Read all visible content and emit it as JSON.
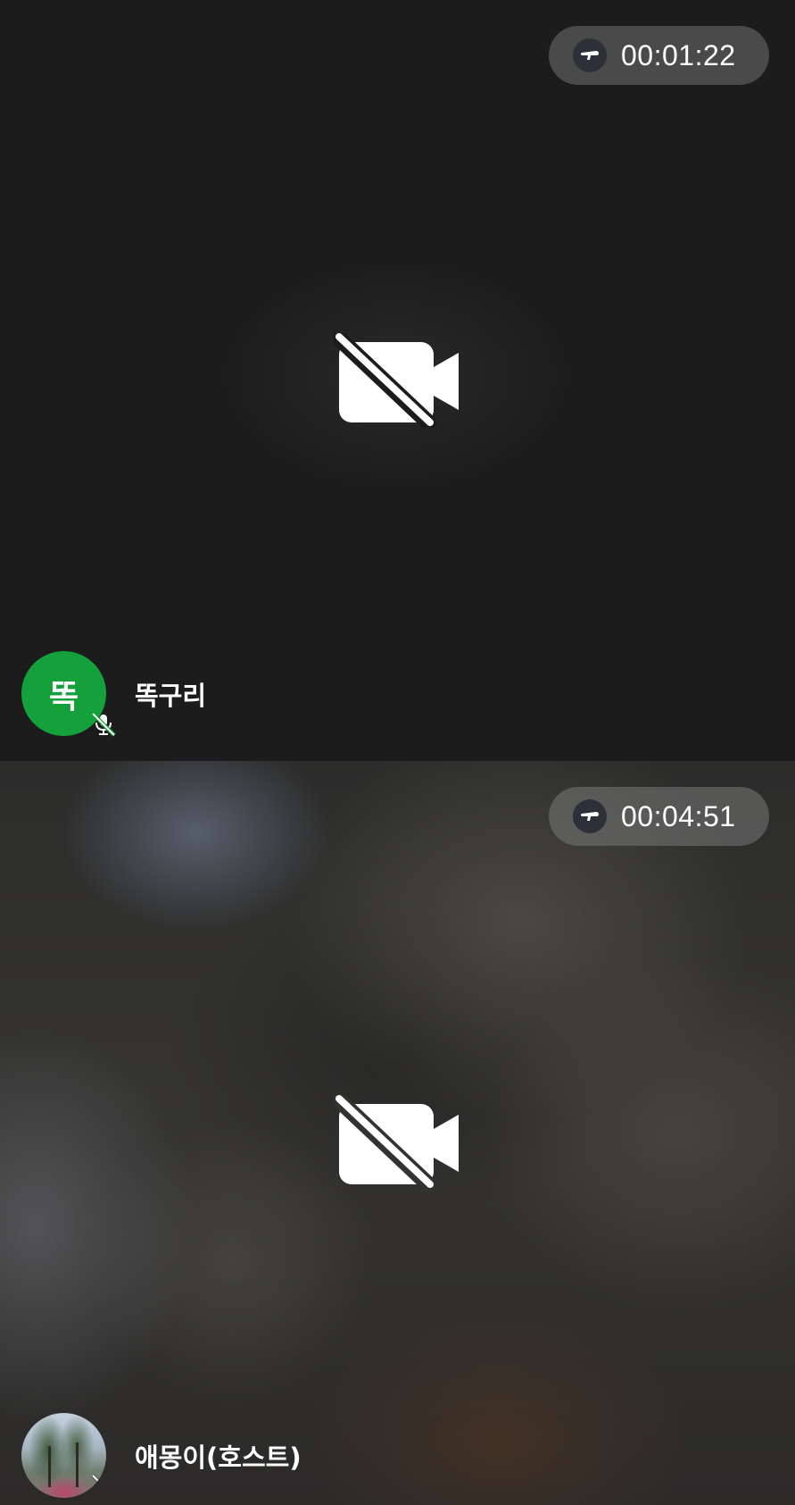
{
  "tiles": [
    {
      "timer": "00:01:22",
      "camera_status_icon": "video-camera-off-icon",
      "participant": {
        "avatar_text": "똑",
        "avatar_color": "#14a13b",
        "name": "똑구리",
        "mic_status_icon": "mic-off-icon"
      }
    },
    {
      "timer": "00:04:51",
      "camera_status_icon": "video-camera-off-icon",
      "participant": {
        "avatar_type": "photo",
        "name": "애몽이(호스트)",
        "mic_status_icon": "mic-off-icon"
      }
    }
  ],
  "colors": {
    "background_dark": "#1c1c1d",
    "timer_pill": "#4a4a4b",
    "record_icon_bg": "#2e3039",
    "text": "#ffffff"
  }
}
